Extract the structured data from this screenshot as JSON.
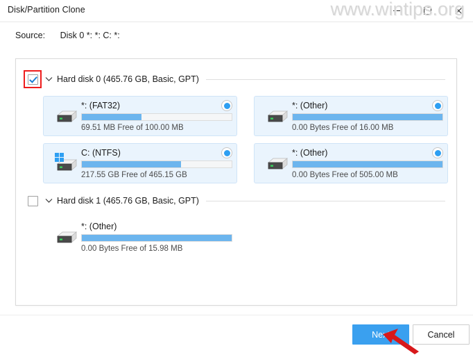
{
  "window": {
    "title": "Disk/Partition Clone",
    "controls": {
      "minimize": "minimize",
      "maximize": "maximize",
      "close": "close"
    }
  },
  "watermark": {
    "text": "www.wintips.org"
  },
  "source": {
    "label": "Source:",
    "value": "Disk 0 *: *: C: *:"
  },
  "disks": [
    {
      "id": "hard-disk-0",
      "title": "Hard disk 0 (465.76 GB, Basic, GPT)",
      "checked": true,
      "highlighted": true,
      "expanded": true,
      "partitions": [
        {
          "name": "*: (FAT32)",
          "free_text": "69.51 MB Free of 100.00 MB",
          "used_percent": 40,
          "selected": true,
          "icon": "external-drive-icon",
          "has_windows_badge": false
        },
        {
          "name": "*: (Other)",
          "free_text": "0.00 Bytes Free of 16.00 MB",
          "used_percent": 100,
          "selected": true,
          "icon": "external-drive-icon",
          "has_windows_badge": false
        },
        {
          "name": "C: (NTFS)",
          "free_text": "217.55 GB Free of 465.15 GB",
          "used_percent": 66,
          "selected": true,
          "icon": "windows-drive-icon",
          "has_windows_badge": true
        },
        {
          "name": "*: (Other)",
          "free_text": "0.00 Bytes Free of 505.00 MB",
          "used_percent": 100,
          "selected": true,
          "icon": "external-drive-icon",
          "has_windows_badge": false
        }
      ]
    },
    {
      "id": "hard-disk-1",
      "title": "Hard disk 1 (465.76 GB, Basic, GPT)",
      "checked": false,
      "highlighted": false,
      "expanded": true,
      "partitions": [
        {
          "name": "*: (Other)",
          "free_text": "0.00 Bytes Free of 15.98 MB",
          "used_percent": 100,
          "selected": false,
          "icon": "external-drive-icon",
          "has_windows_badge": false
        }
      ]
    }
  ],
  "footer": {
    "next_label": "Next",
    "cancel_label": "Cancel"
  },
  "colors": {
    "accent": "#3aa0ef",
    "bar_fill": "#6cb5ee",
    "card_bg": "#eaf4fd",
    "highlight_red": "#ee1c1c",
    "watermark_gray": "#d7d7d7"
  }
}
